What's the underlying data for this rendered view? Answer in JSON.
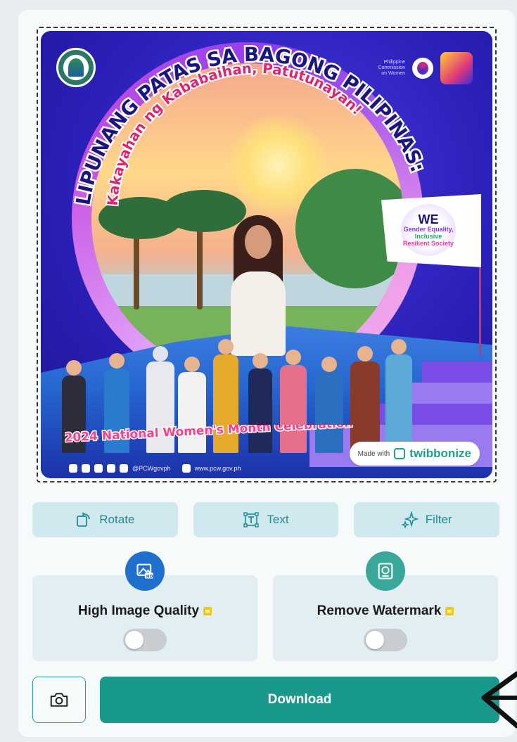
{
  "poster": {
    "title_line1": "LIPUNANG PATAS SA BAGONG PILIPINAS:",
    "title_line2": "Kakayahan ng Kababaihan, Patutunayan!",
    "celebration": "2024 National Women's Month Celebration",
    "pcw_label": "Philippine Commission on Women",
    "flag_badge": {
      "we": "WE",
      "l1": "Gender Equality,",
      "l2": "Inclusive",
      "l3": "Resilient Society"
    },
    "social_handle": "@PCWgovph",
    "website": "www.pcw.gov.ph",
    "made_with": "Made with",
    "brand": "twibbonize"
  },
  "toolbar": {
    "rotate_label": "Rotate",
    "text_label": "Text",
    "filter_label": "Filter"
  },
  "options": {
    "high_quality_label": "High Image Quality",
    "high_quality_on": false,
    "remove_watermark_label": "Remove Watermark",
    "remove_watermark_on": false
  },
  "actions": {
    "download_label": "Download"
  },
  "colors": {
    "accent": "#18998b",
    "tool_bg": "#cfe9ee",
    "tool_text": "#1d8c96",
    "premium": "#f5c518"
  }
}
